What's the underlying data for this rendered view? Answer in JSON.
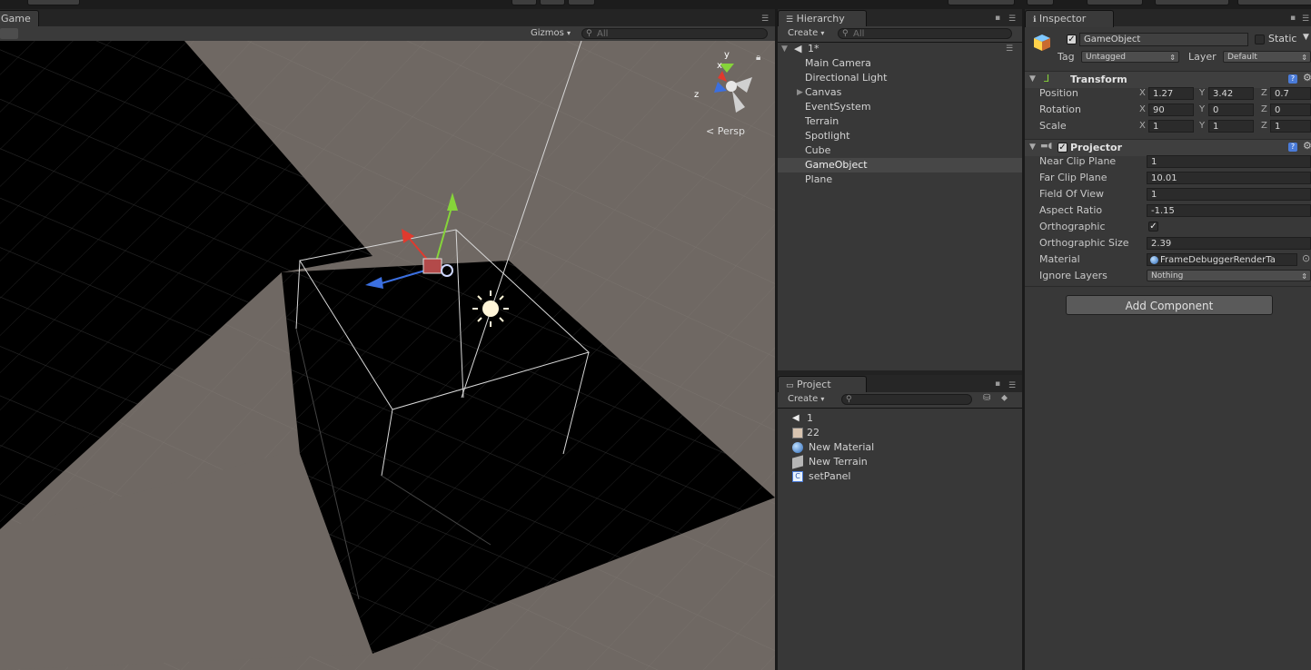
{
  "scene": {
    "tab": "Game",
    "gizmos": "Gizmos",
    "search_placeholder": "All",
    "persp": "Persp",
    "gizmo_axes": {
      "x": "x",
      "y": "y",
      "z": "z"
    }
  },
  "hierarchy": {
    "tab": "Hierarchy",
    "create": "Create",
    "search_placeholder": "All",
    "scene_name": "1*",
    "items": [
      {
        "label": "Main Camera"
      },
      {
        "label": "Directional Light"
      },
      {
        "label": "Canvas"
      },
      {
        "label": "EventSystem"
      },
      {
        "label": "Terrain"
      },
      {
        "label": "Spotlight"
      },
      {
        "label": "Cube"
      },
      {
        "label": "GameObject"
      },
      {
        "label": "Plane"
      }
    ],
    "selected": "GameObject"
  },
  "project": {
    "tab": "Project",
    "create": "Create",
    "items": [
      {
        "label": "1",
        "icon": "unity-scene-icon"
      },
      {
        "label": "22",
        "icon": "image-icon"
      },
      {
        "label": "New Material",
        "icon": "material-sphere-icon"
      },
      {
        "label": "New Terrain",
        "icon": "terrain-cube-icon"
      },
      {
        "label": "setPanel",
        "icon": "script-icon"
      }
    ]
  },
  "inspector": {
    "tab": "Inspector",
    "object_name": "GameObject",
    "static_label": "Static",
    "tag_label": "Tag",
    "tag_value": "Untagged",
    "layer_label": "Layer",
    "layer_value": "Default",
    "transform": {
      "title": "Transform",
      "position_label": "Position",
      "rotation_label": "Rotation",
      "scale_label": "Scale",
      "axis_x": "X",
      "axis_y": "Y",
      "axis_z": "Z",
      "position": {
        "x": "1.27",
        "y": "3.42",
        "z": "0.7"
      },
      "rotation": {
        "x": "90",
        "y": "0",
        "z": "0"
      },
      "scale": {
        "x": "1",
        "y": "1",
        "z": "1"
      }
    },
    "projector": {
      "title": "Projector",
      "near_label": "Near Clip Plane",
      "near": "1",
      "far_label": "Far Clip Plane",
      "far": "10.01",
      "fov_label": "Field Of View",
      "fov": "1",
      "aspect_label": "Aspect Ratio",
      "aspect": "-1.15",
      "ortho_label": "Orthographic",
      "ortho_size_label": "Orthographic Size",
      "ortho_size": "2.39",
      "material_label": "Material",
      "material": "FrameDebuggerRenderTa",
      "ignore_label": "Ignore Layers",
      "ignore": "Nothing"
    },
    "add_component": "Add Component"
  },
  "colors": {
    "panel_bg": "#383838",
    "selection": "#474747",
    "ground": "#6f6863",
    "plane": "#000000",
    "gizmo_red": "#e03a2e",
    "gizmo_green": "#86d43a",
    "gizmo_blue": "#3b6fe0"
  }
}
